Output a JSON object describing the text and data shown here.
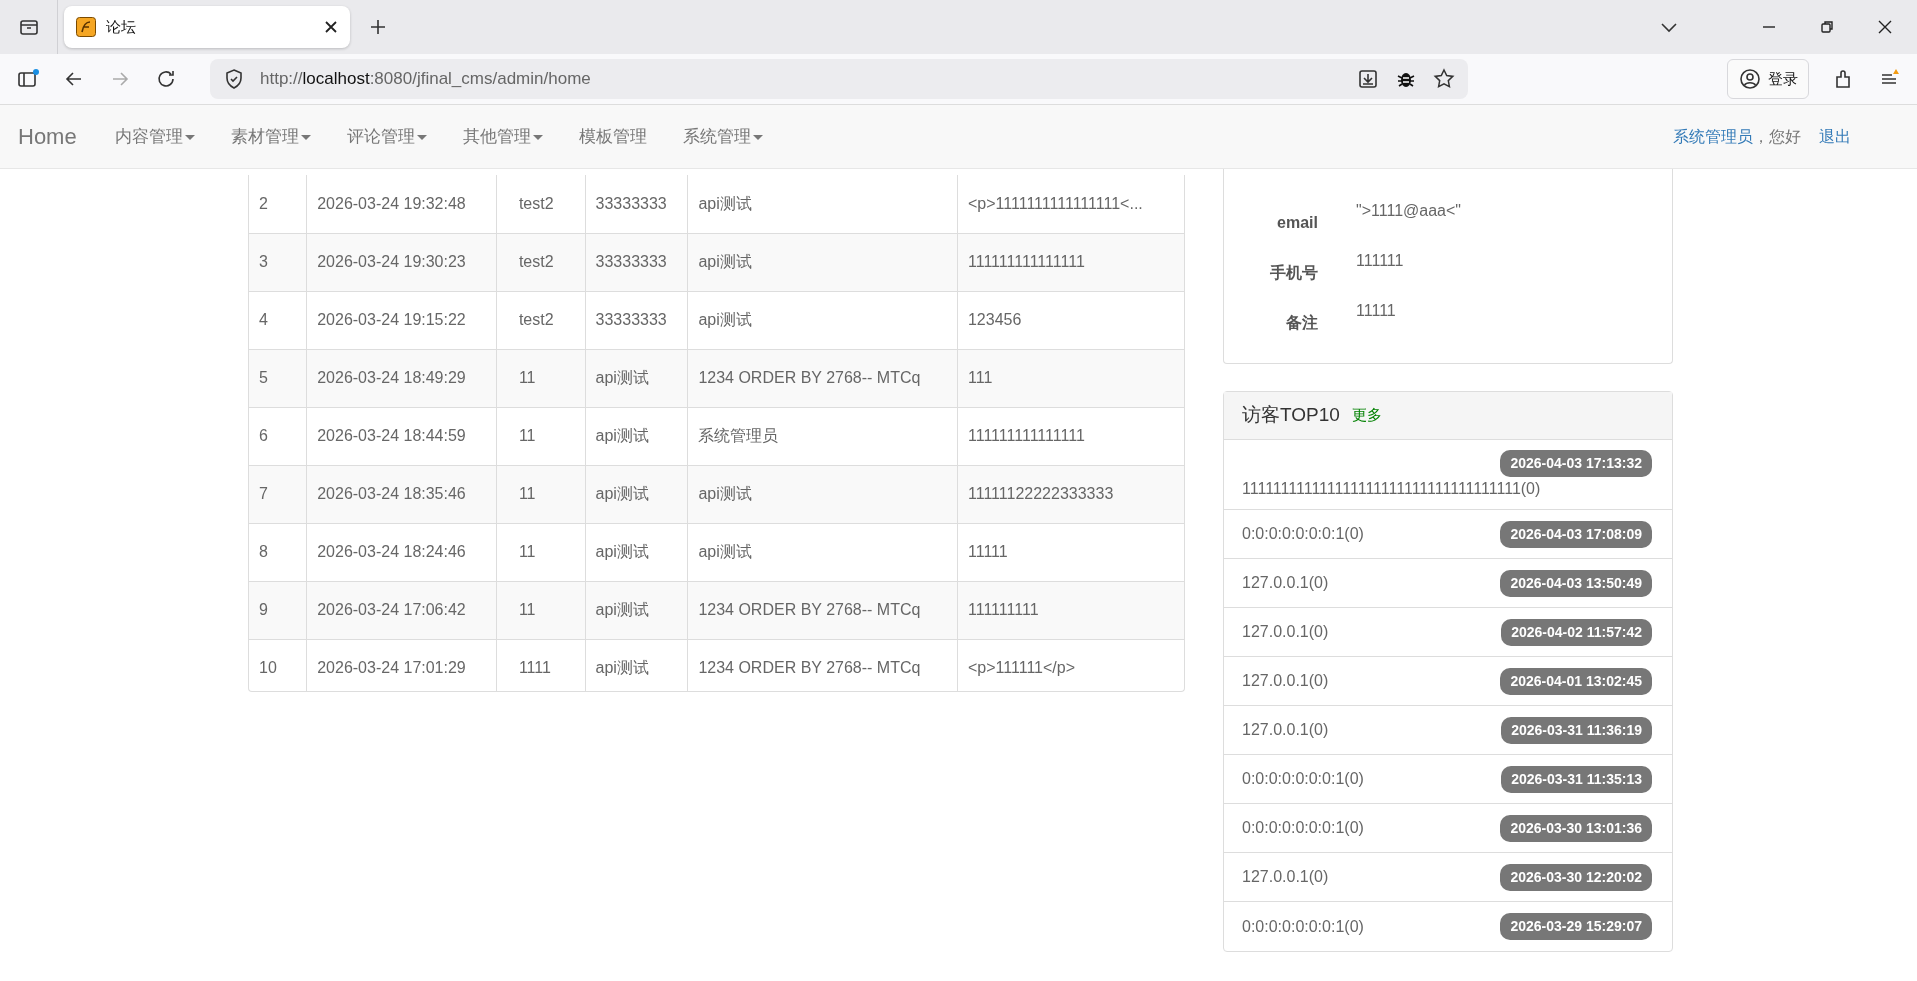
{
  "browser": {
    "tab_title": "论坛",
    "url": "http://**localhost**:8080/jfinal_cms/admin/home",
    "sign_in": "登录"
  },
  "navbar": {
    "brand": "Home",
    "menus": [
      {
        "label": "内容管理",
        "dropdown": true
      },
      {
        "label": "素材管理",
        "dropdown": true
      },
      {
        "label": "评论管理",
        "dropdown": true
      },
      {
        "label": "其他管理",
        "dropdown": true
      },
      {
        "label": "模板管理",
        "dropdown": false
      },
      {
        "label": "系统管理",
        "dropdown": true
      }
    ],
    "user": "系统管理员",
    "greeting": "，您好",
    "logout": "退出"
  },
  "table": {
    "rows": [
      {
        "cells": [
          "2",
          "2026-03-24 19:32:48",
          "test2",
          "33333333",
          "api测试",
          "<p>1111111111111111<..."
        ]
      },
      {
        "cells": [
          "3",
          "2026-03-24 19:30:23",
          "test2",
          "33333333",
          "api测试",
          "111111111111111"
        ]
      },
      {
        "cells": [
          "4",
          "2026-03-24 19:15:22",
          "test2",
          "33333333",
          "api测试",
          "123456"
        ]
      },
      {
        "cells": [
          "5",
          "2026-03-24 18:49:29",
          "11",
          "api测试",
          "1234 ORDER BY 2768-- MTCq",
          "111"
        ]
      },
      {
        "cells": [
          "6",
          "2026-03-24 18:44:59",
          "11",
          "api测试",
          "系统管理员",
          "111111111111111"
        ]
      },
      {
        "cells": [
          "7",
          "2026-03-24 18:35:46",
          "11",
          "api测试",
          "api测试",
          "11111122222333333"
        ]
      },
      {
        "cells": [
          "8",
          "2026-03-24 18:24:46",
          "11",
          "api测试",
          "api测试",
          "11111"
        ]
      },
      {
        "cells": [
          "9",
          "2026-03-24 17:06:42",
          "11",
          "api测试",
          "1234 ORDER BY 2768-- MTCq",
          "111111111"
        ]
      },
      {
        "cells": [
          "10",
          "2026-03-24 17:01:29",
          "1111",
          "api测试",
          "1234 ORDER BY 2768-- MTCq",
          "<p>111111</p>"
        ]
      }
    ]
  },
  "profile": {
    "fields": [
      {
        "label": "email",
        "value": "\">1111@aaa<\""
      },
      {
        "label": "手机号",
        "value": "111111"
      },
      {
        "label": "备注",
        "value": "11111"
      }
    ]
  },
  "visitors": {
    "title": "访客TOP10",
    "more": "更多",
    "items": [
      {
        "name": "111111111111111111111111111111111111(0)",
        "time": "2026-04-03 17:13:32"
      },
      {
        "name": "0:0:0:0:0:0:0:1(0)",
        "time": "2026-04-03 17:08:09"
      },
      {
        "name": "127.0.0.1(0)",
        "time": "2026-04-03 13:50:49"
      },
      {
        "name": "127.0.0.1(0)",
        "time": "2026-04-02 11:57:42"
      },
      {
        "name": "127.0.0.1(0)",
        "time": "2026-04-01 13:02:45"
      },
      {
        "name": "127.0.0.1(0)",
        "time": "2026-03-31 11:36:19"
      },
      {
        "name": "0:0:0:0:0:0:0:1(0)",
        "time": "2026-03-31 11:35:13"
      },
      {
        "name": "0:0:0:0:0:0:0:1(0)",
        "time": "2026-03-30 13:01:36"
      },
      {
        "name": "127.0.0.1(0)",
        "time": "2026-03-30 12:20:02"
      },
      {
        "name": "0:0:0:0:0:0:0:1(0)",
        "time": "2026-03-29 15:29:07"
      }
    ]
  }
}
